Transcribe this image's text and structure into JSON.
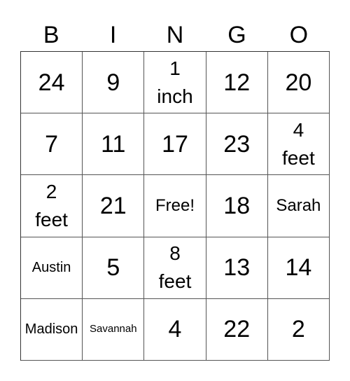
{
  "header": [
    "B",
    "I",
    "N",
    "G",
    "O"
  ],
  "cells": [
    {
      "text": "24",
      "size": "big"
    },
    {
      "text": "9",
      "size": "big"
    },
    {
      "text": "1\ninch",
      "size": "mid"
    },
    {
      "text": "12",
      "size": "big"
    },
    {
      "text": "20",
      "size": "big"
    },
    {
      "text": "7",
      "size": "big"
    },
    {
      "text": "11",
      "size": "big"
    },
    {
      "text": "17",
      "size": "big"
    },
    {
      "text": "23",
      "size": "big"
    },
    {
      "text": "4\nfeet",
      "size": "mid"
    },
    {
      "text": "2\nfeet",
      "size": "mid"
    },
    {
      "text": "21",
      "size": "big"
    },
    {
      "text": "Free!",
      "size": "med"
    },
    {
      "text": "18",
      "size": "big"
    },
    {
      "text": "Sarah",
      "size": "med"
    },
    {
      "text": "Austin",
      "size": "small"
    },
    {
      "text": "5",
      "size": "big"
    },
    {
      "text": "8\nfeet",
      "size": "mid"
    },
    {
      "text": "13",
      "size": "big"
    },
    {
      "text": "14",
      "size": "big"
    },
    {
      "text": "Madison",
      "size": "small"
    },
    {
      "text": "Savannah",
      "size": "tiny"
    },
    {
      "text": "4",
      "size": "big"
    },
    {
      "text": "22",
      "size": "big"
    },
    {
      "text": "2",
      "size": "big"
    }
  ]
}
